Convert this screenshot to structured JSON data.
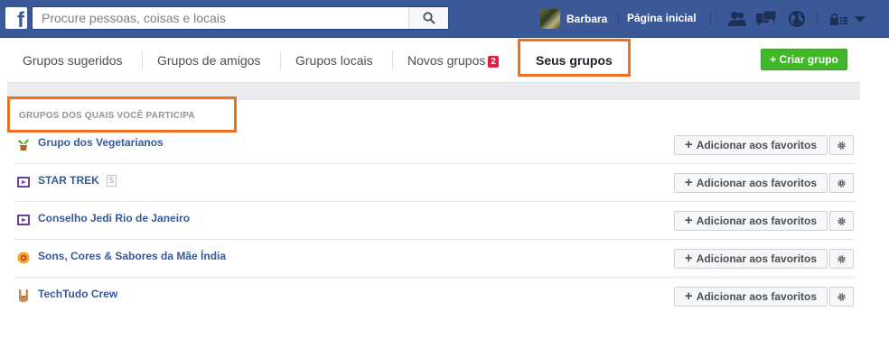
{
  "colors": {
    "brand_blue": "#3b5998",
    "highlight_orange": "#f26f21",
    "create_green": "#42b72a",
    "link_blue": "#365899",
    "notification_red": "#e41e3f"
  },
  "header": {
    "logo_glyph": "f",
    "search": {
      "placeholder": "Procure pessoas, coisas e locais",
      "value": ""
    },
    "search_icon": "magnifier-icon",
    "user_name": "Barbara",
    "home_label": "Página inicial",
    "icons": [
      "friend-requests-icon",
      "messages-icon",
      "notifications-globe-icon",
      "privacy-lock-icon",
      "dropdown-arrow-icon"
    ]
  },
  "tabs": [
    {
      "label": "Grupos sugeridos"
    },
    {
      "label": "Grupos de amigos"
    },
    {
      "label": "Grupos locais"
    },
    {
      "label": "Novos grupos",
      "badge": "2"
    },
    {
      "label": "Seus grupos",
      "active": true
    }
  ],
  "create_group_label": "+ Criar grupo",
  "section_title": "GRUPOS DOS QUAIS VOCÊ PARTICIPA",
  "groups": [
    {
      "name": "Grupo dos Vegetarianos",
      "icon": "potted-plant-icon"
    },
    {
      "name": "STAR TREK",
      "icon": "movie-clapper-icon",
      "count": "5"
    },
    {
      "name": "Conselho Jedi Rio de Janeiro",
      "icon": "movie-clapper-icon"
    },
    {
      "name": "Sons, Cores & Sabores da Mãe Índia",
      "icon": "sun-flower-icon"
    },
    {
      "name": "TechTudo Crew",
      "icon": "rock-hand-icon"
    }
  ],
  "favorite_button_label": "Adicionar aos favoritos",
  "settings_icon": "gear-icon"
}
